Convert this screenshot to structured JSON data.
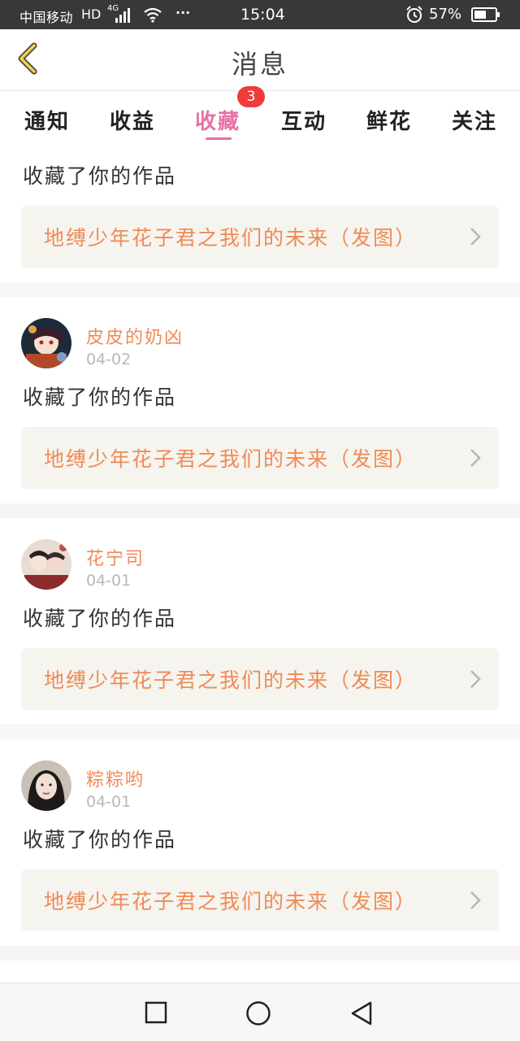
{
  "status_bar": {
    "carrier": "中国移动",
    "hd": "HD",
    "network": "4G",
    "time": "15:04",
    "battery_percent": "57%",
    "icons": [
      "signal-icon",
      "wifi-icon",
      "more-dots-icon",
      "alarm-icon",
      "battery-icon"
    ]
  },
  "header": {
    "title": "消息",
    "back_icon": "chevron-left-icon"
  },
  "tabs": {
    "items": [
      {
        "label": "通知"
      },
      {
        "label": "收益"
      },
      {
        "label": "收藏"
      },
      {
        "label": "互动"
      },
      {
        "label": "鲜花"
      },
      {
        "label": "关注"
      }
    ],
    "active_index": 2,
    "badge_count": "3"
  },
  "feed": {
    "first": {
      "action": "收藏了你的作品",
      "work_title": "地缚少年花子君之我们的未来（发图）"
    },
    "items": [
      {
        "user": "皮皮的奶凶",
        "date": "04-02",
        "action": "收藏了你的作品",
        "work_title": "地缚少年花子君之我们的未来（发图）"
      },
      {
        "user": "花宁司",
        "date": "04-01",
        "action": "收藏了你的作品",
        "work_title": "地缚少年花子君之我们的未来（发图）"
      },
      {
        "user": "粽粽哟",
        "date": "04-01",
        "action": "收藏了你的作品",
        "work_title": "地缚少年花子君之我们的未来（发图）"
      }
    ]
  },
  "nav_bar": {
    "icons": [
      "recent-apps-square-icon",
      "home-circle-icon",
      "back-triangle-icon"
    ]
  },
  "colors": {
    "accent_pink": "#e870a6",
    "orange_text": "#f08a56",
    "badge_red": "#ef3b3b",
    "link_bg": "#f5f4ef",
    "header_chevron": "#f2d04b"
  }
}
